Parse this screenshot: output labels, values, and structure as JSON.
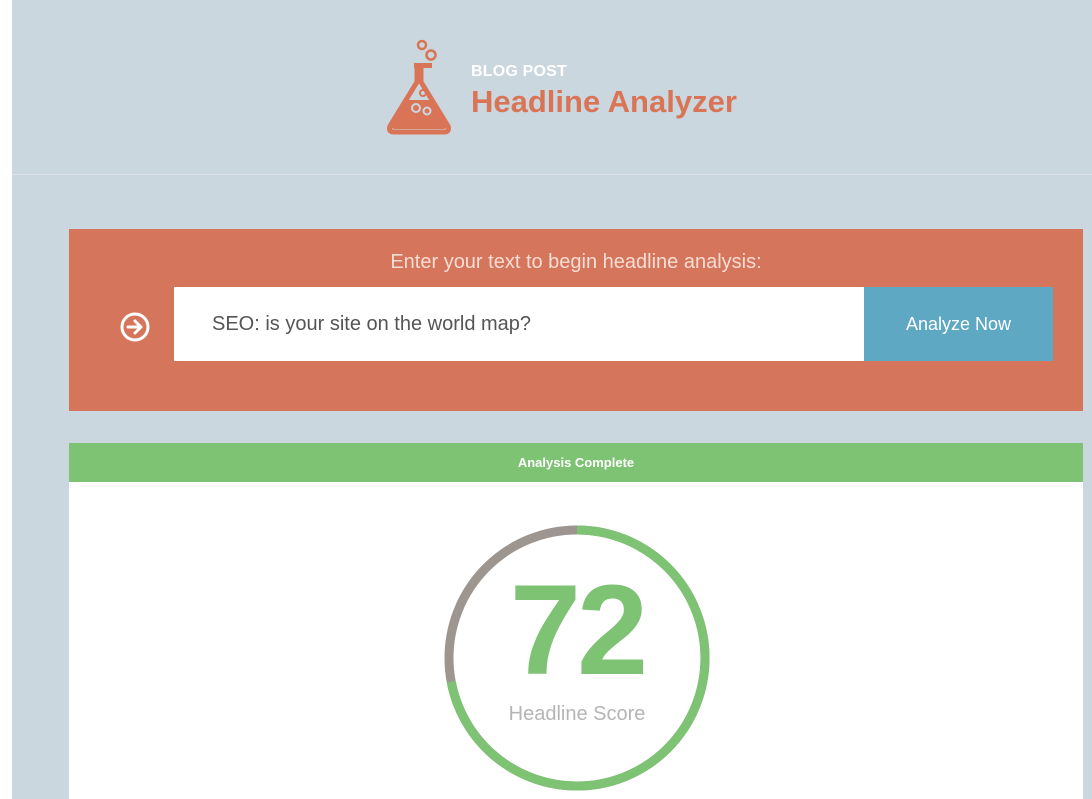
{
  "header": {
    "logo_small": "BLOG POST",
    "logo_title": "Headline Analyzer",
    "logo_icon": "flask-icon"
  },
  "input": {
    "prompt": "Enter your text to begin headline analysis:",
    "value": "SEO: is your site on the world map?",
    "go_icon": "circle-arrow-right-icon",
    "button_label": "Analyze Now"
  },
  "result": {
    "status": "Analysis Complete",
    "score": "72",
    "score_fraction": 0.72,
    "score_label": "Headline Score"
  },
  "colors": {
    "brand": "#d97556",
    "panel": "#d5755b",
    "button": "#5fa8c4",
    "success": "#7dc373",
    "ring_track": "#9c9590",
    "background": "#cbd7df"
  }
}
